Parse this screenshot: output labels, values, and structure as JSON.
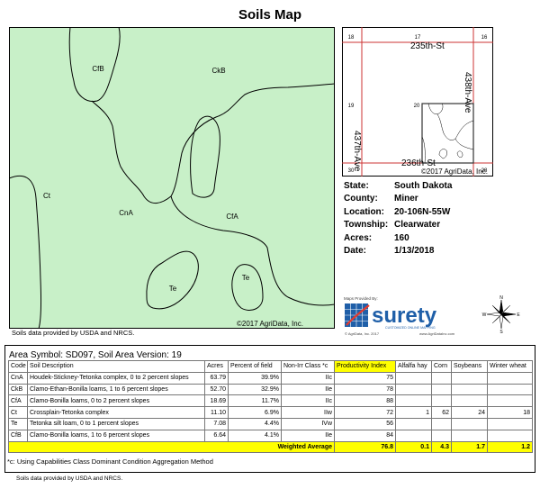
{
  "title": "Soils Map",
  "main_map": {
    "credit": "©2017 AgriData, Inc.",
    "units": [
      {
        "code": "CfB",
        "fill": "#c8f0c8"
      },
      {
        "code": "CkB",
        "fill": "#c8f0c8"
      },
      {
        "code": "Ct",
        "fill": "#c8f0c8"
      },
      {
        "code": "CnA",
        "fill": "#c8f0c8"
      },
      {
        "code": "CfA",
        "fill": "#c8f0c8"
      },
      {
        "code": "Te",
        "fill": "#c8f0c8"
      },
      {
        "code": "Te",
        "fill": "#c8f0c8"
      }
    ]
  },
  "locator": {
    "credit": "©2017 AgriData, Inc.",
    "sections": [
      "18",
      "17",
      "16",
      "19",
      "20",
      "30",
      "28"
    ],
    "roads": [
      "235th-St",
      "236th-St",
      "437th-Ave",
      "438th-Ave"
    ]
  },
  "info": [
    {
      "label": "State:",
      "value": "South Dakota"
    },
    {
      "label": "County:",
      "value": "Miner"
    },
    {
      "label": "Location:",
      "value": "20-106N-55W"
    },
    {
      "label": "Township:",
      "value": "Clearwater"
    },
    {
      "label": "Acres:",
      "value": "160"
    },
    {
      "label": "Date:",
      "value": "1/13/2018"
    }
  ],
  "usda_credit": "Soils data provided by USDA and NRCS.",
  "surety": {
    "maps_provided_by": "Maps Provided By:",
    "brand": "surety",
    "tagline": "CUSTOMIZED ONLINE MAPPING",
    "copyright": "© AgriData, Inc. 2017",
    "url": "www.AgriDataInc.com"
  },
  "compass": {
    "n": "N",
    "s": "S",
    "e": "E",
    "w": "W"
  },
  "legend": {
    "area_symbol": "Area Symbol: SD097, Soil Area Version: 19",
    "headers": [
      "Code",
      "Soil Description",
      "Acres",
      "Percent of field",
      "Non-Irr Class *c",
      "Productivity Index",
      "Alfalfa hay",
      "Corn",
      "Soybeans",
      "Winter wheat"
    ],
    "rows": [
      [
        "CnA",
        "Houdek-Stickney-Tetonka complex, 0 to 2 percent slopes",
        "63.79",
        "39.9%",
        "IIc",
        "75",
        "",
        "",
        "",
        ""
      ],
      [
        "CkB",
        "Clamo-Ethan-Bonilla loams, 1 to 6 percent slopes",
        "52.70",
        "32.9%",
        "IIe",
        "78",
        "",
        "",
        "",
        ""
      ],
      [
        "CfA",
        "Clamo-Bonilla loams, 0 to 2 percent slopes",
        "18.69",
        "11.7%",
        "IIc",
        "88",
        "",
        "",
        "",
        ""
      ],
      [
        "Ct",
        "Crossplain-Tetonka complex",
        "11.10",
        "6.9%",
        "IIw",
        "72",
        "1",
        "62",
        "24",
        "18"
      ],
      [
        "Te",
        "Tetonka silt loam, 0 to 1 percent slopes",
        "7.08",
        "4.4%",
        "IVw",
        "56",
        "",
        "",
        "",
        ""
      ],
      [
        "CfB",
        "Clamo-Bonilla loams, 1 to 6 percent slopes",
        "6.64",
        "4.1%",
        "IIe",
        "84",
        "",
        "",
        "",
        ""
      ]
    ],
    "weighted": {
      "label": "Weighted Average",
      "pi": "76.8",
      "alfalfa": "0.1",
      "corn": "4.3",
      "soybeans": "1.7",
      "wheat": "1.2"
    }
  },
  "footnote": "*c: Using Capabilities Class Dominant Condition Aggregation Method",
  "usda_credit_2": "Soils data provided by USDA and NRCS."
}
